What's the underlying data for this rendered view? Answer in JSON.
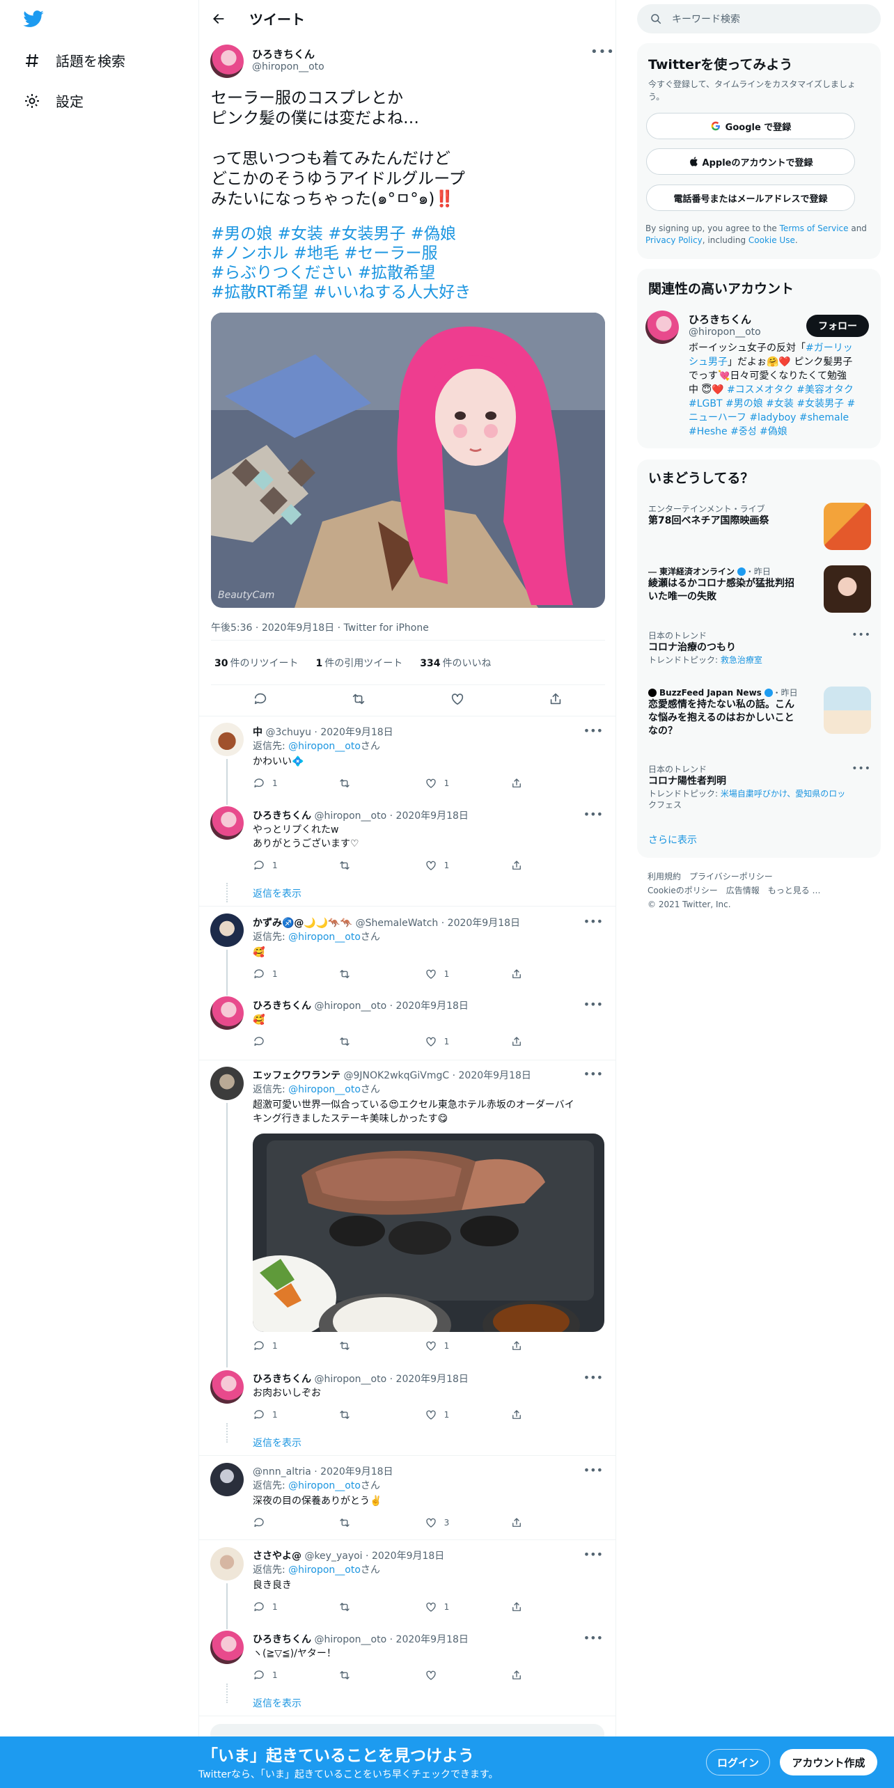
{
  "colors": {
    "accent": "#1d9bf0",
    "link": "#1b95e0",
    "like_pink": "#f91880"
  },
  "leftnav": {
    "logo": "twitter-bird-icon",
    "items": [
      {
        "label": "話題を検索",
        "icon": "hashtag-icon"
      },
      {
        "label": "設定",
        "icon": "gear-icon"
      }
    ]
  },
  "header": {
    "title": "ツイート",
    "back_icon": "arrow-left-icon"
  },
  "tweet": {
    "name": "ひろきちくん",
    "handle": "@hiropon__oto",
    "text": "セーラー服のコスプレとか\nピンク髪の僕には変だよね…\n\nって思いつつも着てみたんだけど\nどこかのそうゆうアイドルグループ\nみたいになっちゃった(๑°ㅁ°๑)‼️",
    "hashtags": [
      [
        "#男の娘",
        "#女装",
        "#女装男子",
        "#偽娘"
      ],
      [
        "#ノンホル",
        "#地毛",
        "#セーラー服"
      ],
      [
        "#らぶりつください",
        "#拡散希望"
      ],
      [
        "#拡散RT希望",
        "#いいねする人大好き"
      ]
    ],
    "photo_watermark": "BeautyCam",
    "time": "午後5:36",
    "date": "2020年9月18日",
    "source": "Twitter for iPhone",
    "retweets": "30",
    "retweets_label": "件のリツイート",
    "quotes": "1",
    "quotes_label": "件の引用ツイート",
    "likes": "334",
    "likes_label": "件のいいね"
  },
  "replies": [
    {
      "name": "中",
      "handle": "@3chuyu",
      "date": "2020年9月18日",
      "reply_prefix": "返信先:",
      "reply_to": "@hiropon__oto",
      "reply_suffix": "さん",
      "text": "かわいい💠",
      "reply_count": "1",
      "like_count": "1"
    },
    {
      "name": "ひろきちくん",
      "handle": "@hiropon__oto",
      "date": "2020年9月18日",
      "text1": "やっとリプくれたw",
      "text2": "ありがとうございます♡",
      "reply_count": "1",
      "like_count": "1",
      "show_replies": "返信を表示"
    },
    {
      "name": "かずみ♐️@🌙🌙🦘🦘",
      "handle": "@ShemaleWatch",
      "date": "2020年9月18日",
      "reply_prefix": "返信先:",
      "reply_to": "@hiropon__oto",
      "reply_suffix": "さん",
      "text": "🥰",
      "reply_count": "1",
      "like_count": "1"
    },
    {
      "name": "ひろきちくん",
      "handle": "@hiropon__oto",
      "date": "2020年9月18日",
      "text": "🥰",
      "reply_count": "",
      "like_count": "1"
    },
    {
      "name": "エッフェクワランテ",
      "handle": "@9JNOK2wkqGiVmgC",
      "date": "2020年9月18日",
      "reply_prefix": "返信先:",
      "reply_to": "@hiropon__oto",
      "reply_suffix": "さん",
      "text1": "超激可愛い世界一似合っている😍エクセル東急ホテル赤坂のオーダーバイ",
      "text2": "キング行きましたステーキ美味しかったす😋",
      "reply_count": "1",
      "like_count": "1"
    },
    {
      "name": "ひろきちくん",
      "handle": "@hiropon__oto",
      "date": "2020年9月18日",
      "text": "お肉おいしぞお",
      "reply_count": "1",
      "like_count": "1",
      "show_replies": "返信を表示"
    },
    {
      "name": "",
      "handle": "@nnn_altria",
      "date": "2020年9月18日",
      "reply_prefix": "返信先:",
      "reply_to": "@hiropon__oto",
      "reply_suffix": "さん",
      "text": "深夜の目の保養ありがとう✌️",
      "reply_count": "",
      "like_count": "3"
    },
    {
      "name": "ささやよ@",
      "handle": "@key_yayoi",
      "date": "2020年9月18日",
      "reply_prefix": "返信先:",
      "reply_to": "@hiropon__oto",
      "reply_suffix": "さん",
      "text": "良き良き",
      "reply_count": "1",
      "like_count": "1"
    },
    {
      "name": "ひろきちくん",
      "handle": "@hiropon__oto",
      "date": "2020年9月18日",
      "text": "ヽ(≧▽≦)/ヤター！",
      "reply_count": "1",
      "like_count": "",
      "show_replies": "返信を表示"
    }
  ],
  "right": {
    "search_placeholder": "キーワード検索",
    "signup": {
      "title": "Twitterを使ってみよう",
      "subtitle": "今すぐ登録して、タイムラインをカスタマイズしましょう。",
      "google": "Google で登録",
      "apple": "Appleのアカウントで登録",
      "phone": "電話番号またはメールアドレスで登録",
      "terms1": "By signing up, you agree to the ",
      "terms_link1": "Terms of Service",
      "terms2": " and ",
      "terms_link2": "Privacy Policy",
      "terms3": ", including ",
      "terms_link3": "Cookie Use",
      "terms4": "."
    },
    "related": {
      "title": "関連性の高いアカウント",
      "name": "ひろきちくん",
      "handle": "@hiropon__oto",
      "follow": "フォロー",
      "bio_l1_pre": "ボーイッシュ女子の反対「",
      "bio_l1_link": "#ガーリッ",
      "bio_l2_link": "シュ男子",
      "bio_l2_rest": "」だよぉ🤗❤️ ピンク髪男子",
      "bio_l3": "でっす💘日々可愛くなりたくて勉強",
      "bio_l4_pre": "中 😇❤️ ",
      "bio_l4_link": "#コスメオタク #美容オタク",
      "bio_l5": "#LGBT #男の娘 #女装 #女装男子 #",
      "bio_l6": "ニューハーフ #ladyboy #shemale",
      "bio_l7": "#Heshe #중성 #偽娘"
    },
    "trends": {
      "title": "いまどうしてる？",
      "items": [
        {
          "context": "エンターテインメント・ライブ",
          "title": "第78回ベネチア国際映画祭"
        },
        {
          "source": "東洋経済オンライン",
          "time": "・昨日",
          "title1": "綾瀬はるかコロナ感染が猛批判招",
          "title2": "いた唯一の失敗"
        },
        {
          "context": "日本のトレンド",
          "title": "コロナ治療のつもり",
          "sub_pre": "トレンドトピック: ",
          "sub_link": "救急治療室"
        },
        {
          "source": "BuzzFeed Japan News",
          "time": "・昨日",
          "title1": "恋愛感情を持たない私の話。こん",
          "title2": "な悩みを抱えるのはおかしいこと",
          "title3": "なの？"
        },
        {
          "context": "日本のトレンド",
          "title": "コロナ陽性者判明",
          "sub_pre": "トレンドトピック: ",
          "sub_link1": "米場自粛呼びかけ、愛知県のロッ",
          "sub_link2": "クフェス"
        }
      ],
      "more": "さらに表示"
    },
    "footer": {
      "l1": "利用規約　プライバシーポリシー",
      "l2": "Cookieのポリシー　広告情報　もっと見る …",
      "l3": "© 2021 Twitter, Inc."
    }
  },
  "bottombar": {
    "title": "「いま」起きていることを見つけよう",
    "subtitle": "Twitterなら、「いま」起きていることをいち早くチェックできます。",
    "login": "ログイン",
    "signup": "アカウント作成"
  }
}
